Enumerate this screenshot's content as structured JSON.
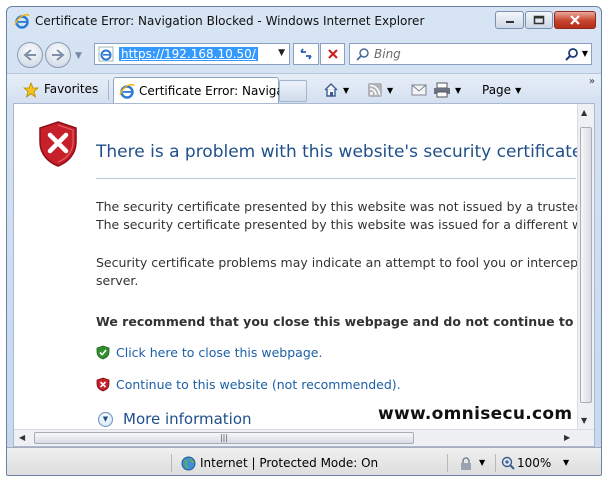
{
  "window": {
    "title": "Certificate Error: Navigation Blocked - Windows Internet Explorer"
  },
  "address_bar": {
    "url": "https://192.168.10.50/"
  },
  "search": {
    "placeholder": "Bing"
  },
  "favorites_bar": {
    "favorites_label": "Favorites",
    "tab_label": "Certificate Error: Naviga...",
    "page_menu_label": "Page"
  },
  "content": {
    "heading": "There is a problem with this website's security certificate.",
    "line1": "The security certificate presented by this website was not issued by a trusted c",
    "line2": "The security certificate presented by this website was issued for a different web",
    "line3": "Security certificate problems may indicate an attempt to fool you or intercept a",
    "line4": "server.",
    "recommend": "We recommend that you close this webpage and do not continue to this",
    "close_link": "Click here to close this webpage.",
    "continue_link": "Continue to this website (not recommended).",
    "more_info": "More information",
    "watermark": "www.omnisecu.com"
  },
  "status_bar": {
    "zone_text": "Internet | Protected Mode: On",
    "zoom": "100%"
  },
  "colors": {
    "heading": "#1f4f8a",
    "link": "#1c5fa8",
    "shield_red": "#c8202a",
    "shield_green": "#2f8f2f"
  },
  "icons": [
    "ie-icon",
    "back-arrow-icon",
    "forward-arrow-icon",
    "certificate-icon",
    "stop-icon",
    "search-icon",
    "star-icon",
    "home-icon",
    "rss-icon",
    "mail-icon",
    "print-icon",
    "shield-error-icon",
    "shield-ok-icon",
    "globe-icon",
    "zoom-icon"
  ]
}
